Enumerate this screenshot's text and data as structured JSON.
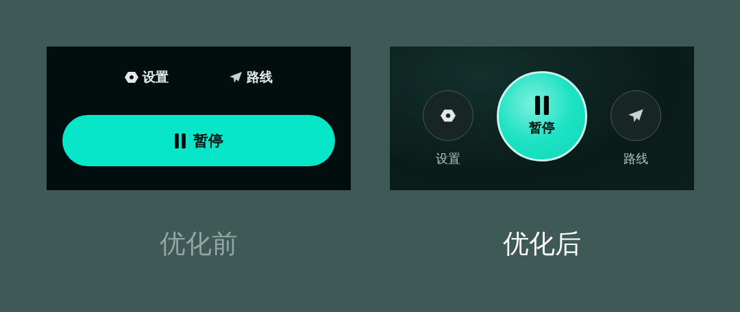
{
  "panels": [
    {
      "kind": "bar",
      "settings_label": "设置",
      "route_label": "路线",
      "pause_label": "暂停",
      "caption": "优化前",
      "emphasized": false
    },
    {
      "kind": "round",
      "settings_label": "设置",
      "route_label": "路线",
      "pause_label": "暂停",
      "caption": "优化后",
      "emphasized": true
    }
  ]
}
